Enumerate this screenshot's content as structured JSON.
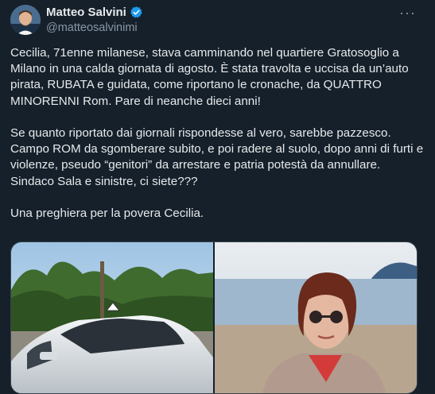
{
  "author": {
    "name": "Matteo Salvini",
    "handle": "@matteosalvinimi",
    "verified": true
  },
  "more_label": "···",
  "tweet_text": "Cecilia, 71enne milanese, stava camminando nel quartiere Gratosoglio a Milano in una calda giornata di agosto. È stata travolta e uccisa da un’auto pirata, RUBATA e guidata, come riportano le cronache, da QUATTRO MINORENNI Rom. Pare di neanche dieci anni!\n\nSe quanto riportato dai giornali rispondesse al vero, sarebbe pazzesco. Campo ROM da sgomberare subito, e poi radere al suolo, dopo anni di furti e violenze, pseudo “genitori” da arrestare e patria potestà da annullare. Sindaco Sala e sinistre, ci siete???\n\nUna preghiera per la povera Cecilia.",
  "colors": {
    "background": "#15202b",
    "text": "#e7e9ea",
    "secondary": "#8b98a5",
    "verified": "#1d9bf0"
  },
  "icons": {
    "verified": "verified-badge-icon",
    "more": "more-options-icon"
  }
}
